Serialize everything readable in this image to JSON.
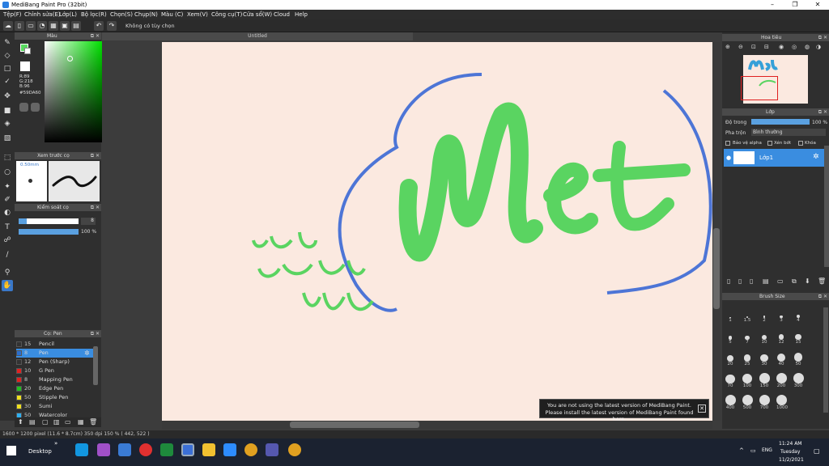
{
  "window": {
    "title": "MediBang Paint Pro (32bit)"
  },
  "menu": [
    "Tệp(F)",
    "Chỉnh sửa(E)",
    "Lớp(L)",
    "Bộ lọc(R)",
    "Chọn(S)",
    "Chụp(N)",
    "Màu (C)",
    "Xem(V)",
    "Công cụ(T)",
    "Cửa sổ(W)",
    "Cloud",
    "Help"
  ],
  "toolbar": {
    "selection_status": "Không có tùy chọn"
  },
  "color_panel": {
    "title": "Màu",
    "r": "R:89",
    "g": "G:218",
    "b": "B:96",
    "hex": "#59DA60",
    "accent": "#59da60"
  },
  "brush_preview": {
    "title": "Xem trước cọ",
    "size": "0.50mm"
  },
  "brush_control": {
    "title": "Kiểm soát cọ",
    "size_value": "8",
    "opacity_value": "100 %"
  },
  "pen_panel": {
    "title": "Cọ: Pen",
    "items": [
      {
        "size": "15",
        "name": "Pencil",
        "color": "#333333"
      },
      {
        "size": "8",
        "name": "Pen",
        "color": "#2a6fd0",
        "selected": true
      },
      {
        "size": "12",
        "name": "Pen (Sharp)",
        "color": "#333333"
      },
      {
        "size": "10",
        "name": "G Pen",
        "color": "#e02020"
      },
      {
        "size": "8",
        "name": "Mapping Pen",
        "color": "#e02020"
      },
      {
        "size": "20",
        "name": "Edge Pen",
        "color": "#20c020"
      },
      {
        "size": "50",
        "name": "Stipple Pen",
        "color": "#f0e020"
      },
      {
        "size": "30",
        "name": "Sumi",
        "color": "#f0e020"
      },
      {
        "size": "50",
        "name": "Watercolor",
        "color": "#30b0f0"
      }
    ]
  },
  "canvas": {
    "tab_title": "Untitled"
  },
  "notice": {
    "line1": "You are not using the latest version of MediBang Paint.",
    "line2": "Please install the latest version of MediBang Paint found here."
  },
  "navigator": {
    "title": "Hoa tiêu"
  },
  "layers": {
    "title": "Lớp",
    "opacity_label": "Độ trong",
    "opacity_value": "100 %",
    "blend_label": "Pha trộn",
    "blend_value": "Bình thường",
    "protect_alpha": "Bảo vệ alpha",
    "clipping": "Xén bớt",
    "lock": "Khóa",
    "layer_name": "Lớp1"
  },
  "brush_size": {
    "title": "Brush Size",
    "sizes": [
      "1",
      "1.5",
      "2",
      "3",
      "4",
      "5",
      "7",
      "10",
      "12",
      "15",
      "20",
      "25",
      "30",
      "40",
      "50",
      "70",
      "100",
      "150",
      "200",
      "300",
      "400",
      "500",
      "700",
      "1000"
    ]
  },
  "status": {
    "text": "1600 * 1200 pixel   (11.6 * 8.7cm)   350 dpi   150 %   ( 442, 522 )"
  },
  "taskbar": {
    "desktop": "Desktop",
    "lang": "ENG",
    "time": "11:24 AM",
    "day": "Tuesday",
    "date": "11/2/2021"
  }
}
